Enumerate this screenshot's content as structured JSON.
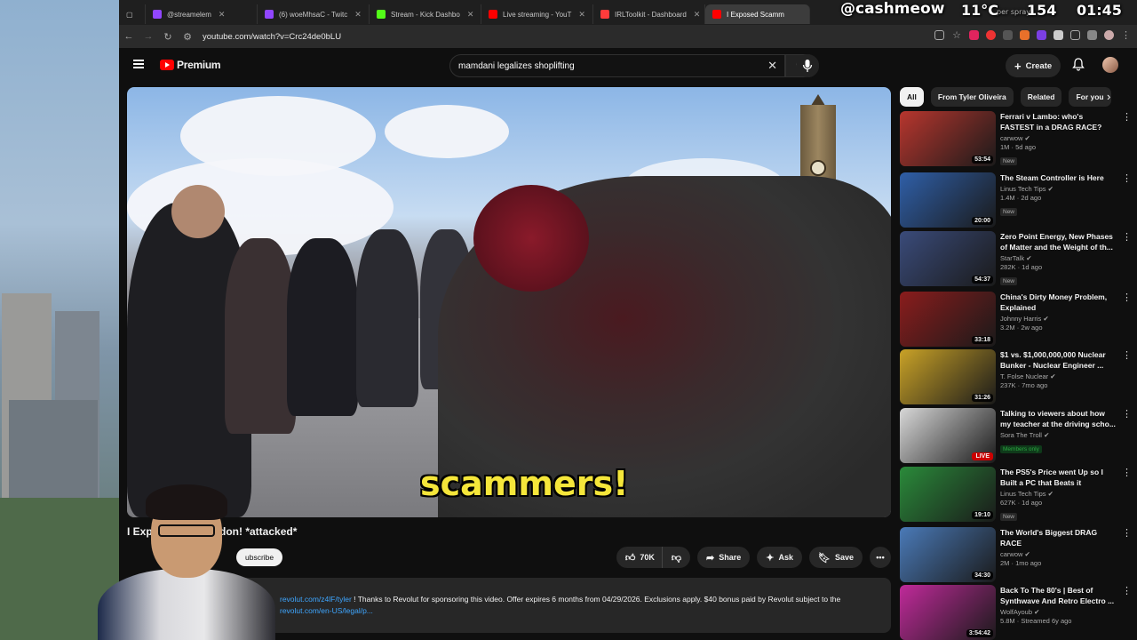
{
  "tabs": [
    {
      "label": "@streamelem",
      "active": false,
      "color": "#9146ff"
    },
    {
      "label": "(6) woeMhsaC - Twitc",
      "active": false,
      "color": "#9146ff"
    },
    {
      "label": "Stream - Kick Dashbo",
      "active": false,
      "color": "#53fc18"
    },
    {
      "label": "Live streaming - YouT",
      "active": false,
      "color": "#ff0000"
    },
    {
      "label": "IRLToolkit - Dashboard",
      "active": false,
      "color": "#ff3b3b"
    },
    {
      "label": "I Exposed Scamm",
      "active": true,
      "color": "#ff0000"
    }
  ],
  "overlay": {
    "handle": "@cashmeow",
    "temp": "11°C",
    "count": "154",
    "time": "01:45",
    "partial": "per spray"
  },
  "address": {
    "url": "youtube.com/watch?v=Crc24de0bLU"
  },
  "header": {
    "logo": "Premium",
    "search_value": "mamdani legalizes shoplifting",
    "create_label": "Create"
  },
  "video": {
    "caption": "scammers!",
    "title": "I Expo    hers in London! *attacked*",
    "subscribe_label": "ubscribe",
    "likes": "70K",
    "share_label": "Share",
    "ask_label": "Ask",
    "save_label": "Save",
    "desc_link1": "revolut.com/z4lF/tyler",
    "desc_text": " ! Thanks to Revolut for sponsoring this video. Offer expires 6 months from 04/29/2026. Exclusions apply. $40 bonus paid by Revolut subject to the",
    "desc_link2": "revolut.com/en-US/legal/p..."
  },
  "chips": [
    "All",
    "From Tyler Oliveira",
    "Related",
    "For you"
  ],
  "recommendations": [
    {
      "title": "Ferrari v Lambo: who's FASTEST in a DRAG RACE?",
      "channel": "carwow",
      "stats": "1M · 5d ago",
      "badge": "New",
      "duration": "53:54",
      "thumb": "#b8362e"
    },
    {
      "title": "The Steam Controller is Here",
      "channel": "Linus Tech Tips",
      "stats": "1.4M · 2d ago",
      "badge": "New",
      "duration": "20:00",
      "thumb": "#2f5fa8"
    },
    {
      "title": "Zero Point Energy, New Phases of Matter and the Weight of th...",
      "channel": "StarTalk",
      "stats": "282K · 1d ago",
      "badge": "New",
      "duration": "54:37",
      "thumb": "#3a4b7a"
    },
    {
      "title": "China's Dirty Money Problem, Explained",
      "channel": "Johnny Harris",
      "stats": "3.2M · 2w ago",
      "badge": "",
      "duration": "33:18",
      "thumb": "#8a1c1c"
    },
    {
      "title": "$1 vs. $1,000,000,000 Nuclear Bunker - Nuclear Engineer ...",
      "channel": "T. Folse Nuclear",
      "stats": "237K · 7mo ago",
      "badge": "",
      "duration": "31:26",
      "thumb": "#c9a227"
    },
    {
      "title": "Talking to viewers about how my teacher at the driving scho...",
      "channel": "Sora The Troll",
      "stats": "",
      "badge": "Members only",
      "duration": "LIVE",
      "thumb": "#d8d8d8"
    },
    {
      "title": "The PS5's Price went Up so I Built a PC that Beats it",
      "channel": "Linus Tech Tips",
      "stats": "627K · 1d ago",
      "badge": "New",
      "duration": "19:10",
      "thumb": "#2a8a3a"
    },
    {
      "title": "The World's Biggest DRAG RACE",
      "channel": "carwow",
      "stats": "2M · 1mo ago",
      "badge": "",
      "duration": "34:30",
      "thumb": "#4a7ab8"
    },
    {
      "title": "Back To The 80's | Best of Synthwave And Retro Electro ...",
      "channel": "WolfAyoub",
      "stats": "5.8M · Streamed 6y ago",
      "badge": "",
      "duration": "3:54:42",
      "thumb": "#c02a9a"
    }
  ]
}
